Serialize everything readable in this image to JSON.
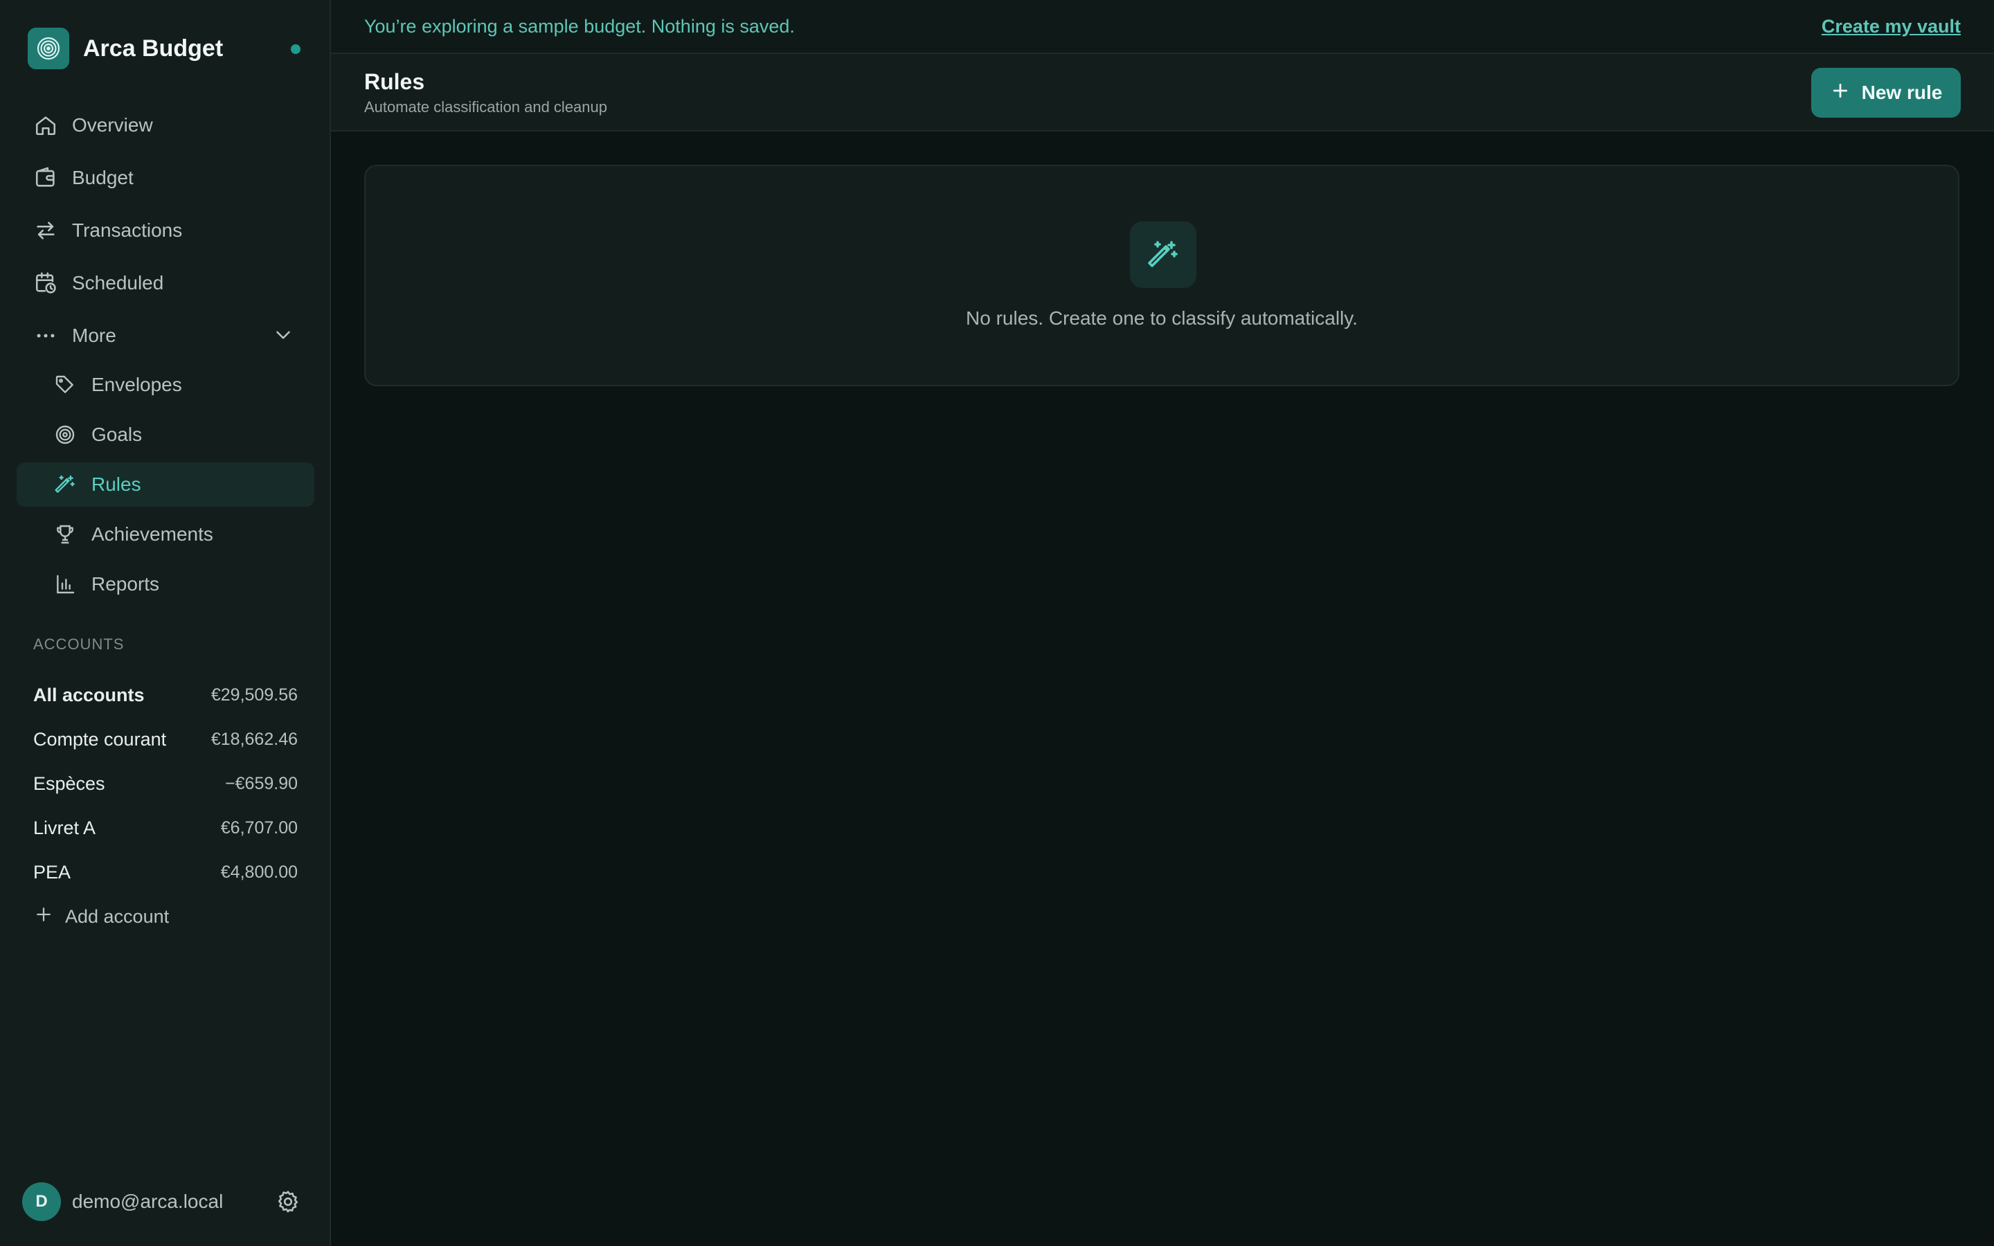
{
  "brand": {
    "name": "Arca Budget"
  },
  "nav": {
    "items": [
      {
        "label": "Overview",
        "icon": "home-icon"
      },
      {
        "label": "Budget",
        "icon": "wallet-icon"
      },
      {
        "label": "Transactions",
        "icon": "arrows-swap-icon"
      },
      {
        "label": "Scheduled",
        "icon": "calendar-clock-icon"
      }
    ],
    "more_label": "More",
    "sub_items": [
      {
        "label": "Envelopes",
        "icon": "tag-icon"
      },
      {
        "label": "Goals",
        "icon": "target-icon"
      },
      {
        "label": "Rules",
        "icon": "magic-wand-icon",
        "active": true
      },
      {
        "label": "Achievements",
        "icon": "trophy-icon"
      },
      {
        "label": "Reports",
        "icon": "bar-chart-icon"
      }
    ]
  },
  "accounts": {
    "heading": "ACCOUNTS",
    "rows": [
      {
        "name": "All accounts",
        "amount": "€29,509.56"
      },
      {
        "name": "Compte courant",
        "amount": "€18,662.46"
      },
      {
        "name": "Espèces",
        "amount": "−€659.90"
      },
      {
        "name": "Livret A",
        "amount": "€6,707.00"
      },
      {
        "name": "PEA",
        "amount": "€4,800.00"
      }
    ],
    "add_label": "Add account"
  },
  "user": {
    "initial": "D",
    "email": "demo@arca.local"
  },
  "banner": {
    "text": "You’re exploring a sample budget. Nothing is saved.",
    "link": "Create my vault"
  },
  "header": {
    "title": "Rules",
    "subtitle": "Automate classification and cleanup",
    "new_button": "New rule"
  },
  "empty_state": {
    "text": "No rules. Create one to classify automatically."
  },
  "colors": {
    "accent": "#1f7b72",
    "accent_text": "#59cfc1",
    "background": "#0b1412",
    "sidebar": "#131e1c"
  }
}
